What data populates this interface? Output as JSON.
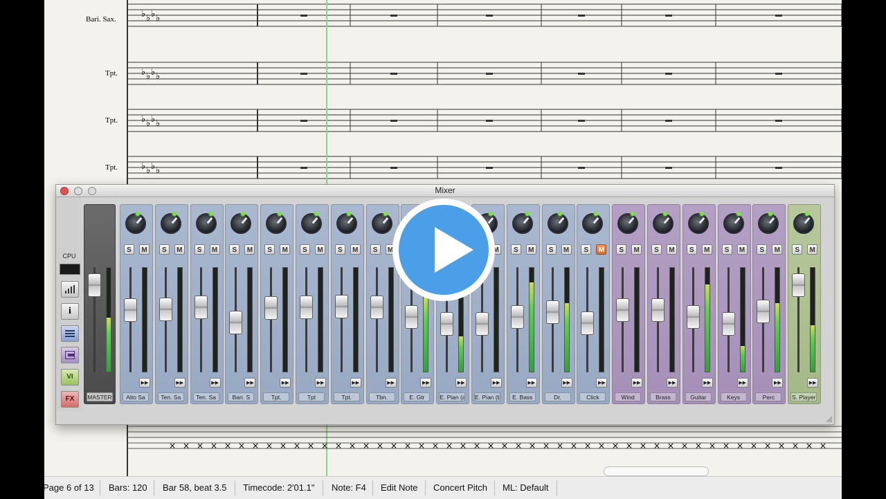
{
  "score": {
    "staves": [
      {
        "label": "Bari. Sax."
      },
      {
        "label": "Tpt."
      },
      {
        "label": "Tpt."
      },
      {
        "label": "Tpt."
      }
    ]
  },
  "mixer": {
    "title": "Mixer",
    "side": {
      "cpu_label": "CPU",
      "buttons": [
        "meters",
        "info",
        "list",
        "groups",
        "VI",
        "FX"
      ]
    },
    "master": {
      "name": "MASTER",
      "fader_level": 0.92,
      "meter_level": 0.52
    },
    "strips": [
      {
        "name": "Alto Sa",
        "color": "blue",
        "fader_level": 0.62,
        "meter_level": 0.0,
        "mute": false
      },
      {
        "name": "Ten. Sa",
        "color": "blue",
        "fader_level": 0.63,
        "meter_level": 0.0,
        "mute": false
      },
      {
        "name": "Ten. Sa",
        "color": "blue",
        "fader_level": 0.65,
        "meter_level": 0.0,
        "mute": false
      },
      {
        "name": "Bari. S",
        "color": "blue",
        "fader_level": 0.47,
        "meter_level": 0.0,
        "mute": false
      },
      {
        "name": "Tpt.",
        "color": "blue",
        "fader_level": 0.64,
        "meter_level": 0.0,
        "mute": false
      },
      {
        "name": "Tpt",
        "color": "blue",
        "fader_level": 0.65,
        "meter_level": 0.0,
        "mute": false
      },
      {
        "name": "Tpt.",
        "color": "blue",
        "fader_level": 0.66,
        "meter_level": 0.0,
        "mute": false
      },
      {
        "name": "Tbn.",
        "color": "blue",
        "fader_level": 0.65,
        "meter_level": 0.0,
        "mute": false
      },
      {
        "name": "E. Gtr",
        "color": "blue",
        "fader_level": 0.53,
        "meter_level": 0.72,
        "mute": false
      },
      {
        "name": "E. Pian (a)",
        "color": "blue",
        "fader_level": 0.45,
        "meter_level": 0.34,
        "mute": false
      },
      {
        "name": "E. Pian (b)",
        "color": "blue",
        "fader_level": 0.45,
        "meter_level": 0.0,
        "mute": false
      },
      {
        "name": "E. Bass",
        "color": "blue",
        "fader_level": 0.53,
        "meter_level": 0.86,
        "mute": false
      },
      {
        "name": "Dr.",
        "color": "blue",
        "fader_level": 0.59,
        "meter_level": 0.66,
        "mute": false
      },
      {
        "name": "Click",
        "color": "blue",
        "fader_level": 0.46,
        "meter_level": 0.0,
        "mute": true
      },
      {
        "name": "Wind",
        "color": "purple",
        "fader_level": 0.62,
        "meter_level": 0.0,
        "mute": false
      },
      {
        "name": "Brass",
        "color": "purple",
        "fader_level": 0.62,
        "meter_level": 0.0,
        "mute": false
      },
      {
        "name": "Guitar",
        "color": "purple",
        "fader_level": 0.53,
        "meter_level": 0.84,
        "mute": false
      },
      {
        "name": "Keys",
        "color": "purple",
        "fader_level": 0.45,
        "meter_level": 0.25,
        "mute": false
      },
      {
        "name": "Perc",
        "color": "purple",
        "fader_level": 0.6,
        "meter_level": 0.66,
        "mute": false
      },
      {
        "name": "S. Player",
        "color": "green",
        "fader_level": 0.92,
        "meter_level": 0.45,
        "mute": false
      }
    ],
    "solo_label": "S",
    "mute_label": "M",
    "colors": {
      "blue": "#9dadc6",
      "purple": "#a993ba",
      "green": "#a8bd8b",
      "mute_on": "#e07a35"
    }
  },
  "status_bar": {
    "page": "Page 6 of 13",
    "bars": "Bars: 120",
    "position": "Bar 58, beat 3.5",
    "timecode": "Timecode: 2'01.1\"",
    "note": "Note: F4",
    "mode": "Edit Note",
    "pitch": "Concert Pitch",
    "layout": "ML: Default"
  },
  "overlay": {
    "icon": "play-icon",
    "color": "#4a9fe8"
  }
}
